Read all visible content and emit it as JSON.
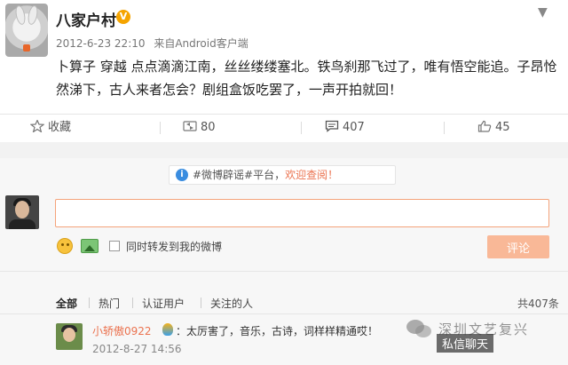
{
  "post": {
    "username": "八家户村",
    "verified_badge": "V",
    "date": "2012-6-23 22:10",
    "source": "来自Android客户端",
    "text": "卜算子 穿越 点点滴滴江南，丝丝缕缕塞北。铁鸟刹那飞过了，唯有悟空能追。子昂怆然涕下，古人来者怎会？剧组盒饭吃罢了，一声开拍就回！",
    "actions": {
      "favorite_label": "收藏",
      "repost_count": "80",
      "comment_count": "407",
      "like_count": "45"
    }
  },
  "comment_box": {
    "notice_info": "i",
    "notice_prefix": "#微博辟谣#平台，",
    "notice_link": "欢迎查阅！",
    "sync_label": "同时转发到我的微博",
    "submit_label": "评论"
  },
  "filters": {
    "tabs": [
      "全部",
      "热门",
      "认证用户",
      "关注的人"
    ],
    "total": "共407条"
  },
  "comments": [
    {
      "user": "小轿傲0922",
      "text": "：太厉害了，音乐，古诗，词样样精通哎！",
      "time": "2012-8-27 14:56"
    }
  ],
  "watermark": {
    "line1": "深圳文艺复兴",
    "line2": "私信聊天"
  },
  "colors": {
    "accent": "#eb7350",
    "verified": "#f5a400",
    "submit_disabled": "#f9b897",
    "input_border": "#f4a37a"
  }
}
